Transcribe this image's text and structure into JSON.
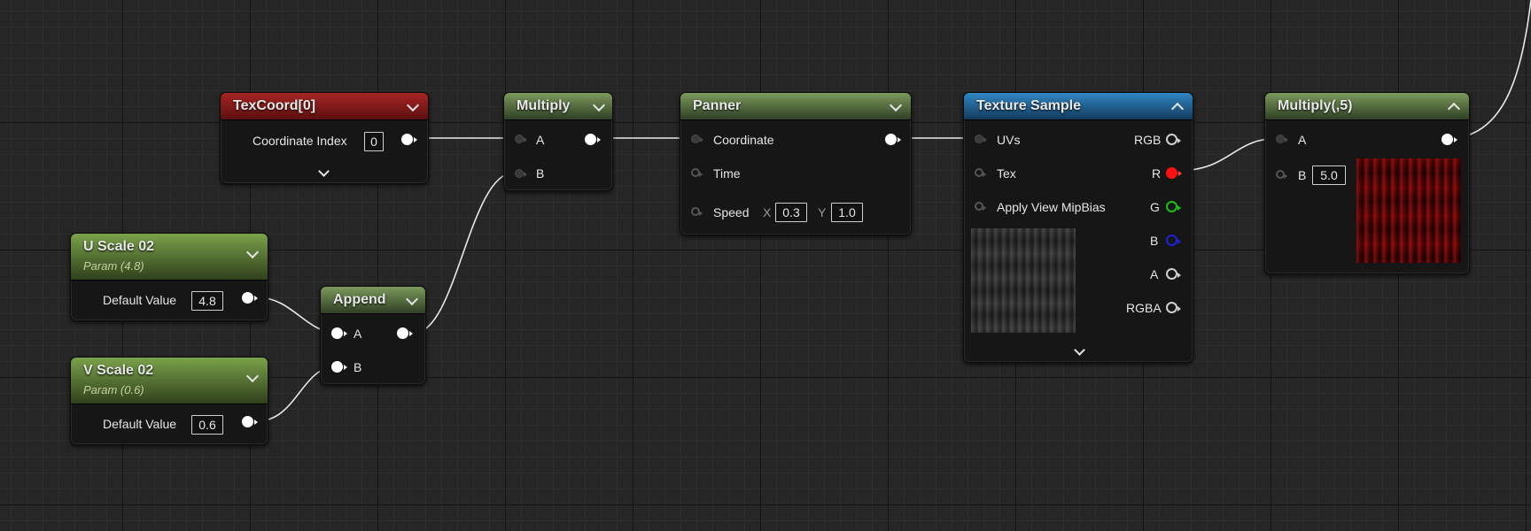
{
  "nodes": {
    "texcoord": {
      "title": "TexCoord[0]",
      "property_label": "Coordinate Index",
      "property_value": "0"
    },
    "u_scale": {
      "title": "U Scale 02",
      "subtitle": "Param (4.8)",
      "property_label": "Default Value",
      "property_value": "4.8"
    },
    "v_scale": {
      "title": "V Scale 02",
      "subtitle": "Param (0.6)",
      "property_label": "Default Value",
      "property_value": "0.6"
    },
    "append": {
      "title": "Append",
      "pin_a": "A",
      "pin_b": "B"
    },
    "multiply": {
      "title": "Multiply",
      "pin_a": "A",
      "pin_b": "B"
    },
    "panner": {
      "title": "Panner",
      "pin_coordinate": "Coordinate",
      "pin_time": "Time",
      "pin_speed": "Speed",
      "speed_x_label": "X",
      "speed_x_value": "0.3",
      "speed_y_label": "Y",
      "speed_y_value": "1.0"
    },
    "texture_sample": {
      "title": "Texture Sample",
      "pin_uvs": "UVs",
      "pin_tex": "Tex",
      "pin_mipbias": "Apply View MipBias",
      "out_rgb": "RGB",
      "out_r": "R",
      "out_g": "G",
      "out_b": "B",
      "out_a": "A",
      "out_rgba": "RGBA"
    },
    "multiply5": {
      "title": "Multiply(,5)",
      "pin_a": "A",
      "pin_b": "B",
      "b_value": "5.0"
    }
  },
  "colors": {
    "graph_background": "#262626",
    "header_red": "#a82424",
    "header_green": "#7c9a5c",
    "header_param_green": "#7aa24a",
    "header_blue": "#2f86c4",
    "wire": "#e8e8e8",
    "pin_red": "#ff1010",
    "pin_green": "#18c018",
    "pin_blue": "#2020d8"
  }
}
